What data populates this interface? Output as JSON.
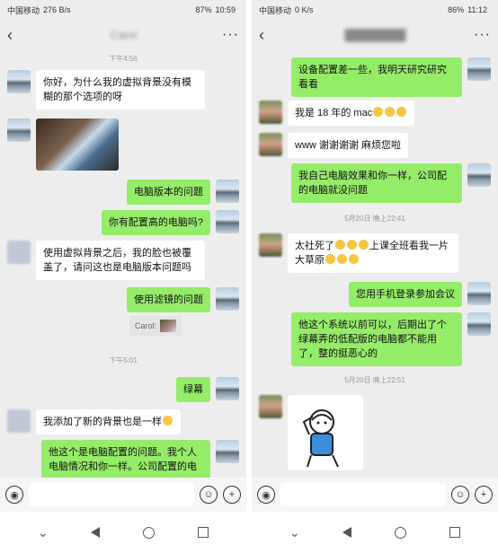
{
  "left": {
    "status": {
      "carrier": "中国移动",
      "data": "276 B/s",
      "battery": "87%",
      "time": "10:59"
    },
    "contact_name": "Carol",
    "timestamps": [
      "下午4:56",
      "下午5:01"
    ],
    "messages": [
      {
        "text": "你好，为什么我的虚拟背景没有模糊的那个选项的呀"
      },
      {
        "text": "电脑版本的问题"
      },
      {
        "text": "你有配置高的电脑吗?"
      },
      {
        "text": "使用虚拟背景之后，我的脸也被覆盖了，请问这也是电脑版本问题吗"
      },
      {
        "text": "使用滤镜的问题"
      },
      {
        "text": "绿幕"
      },
      {
        "text": "我添加了新的背景也是一样"
      },
      {
        "text": "他这个是电脑配置的问题。我个人电脑情况和你一样。公司配置的电"
      }
    ],
    "quote_label": "Carol:"
  },
  "right": {
    "status": {
      "carrier": "中国移动",
      "data": "0 K/s",
      "battery": "86%",
      "time": "11:12"
    },
    "contact_name": "████████",
    "timestamps": [
      "5月20日 晚上22:41",
      "5月20日 晚上22:51"
    ],
    "messages": [
      {
        "text": "设备配置差一些，我明天研究研究看看"
      },
      {
        "text": "我是 18 年的 mac"
      },
      {
        "text": "www 谢谢谢谢 麻烦您啦"
      },
      {
        "text": "我自己电脑效果和你一样，公司配的电脑就没问题"
      },
      {
        "text": "太社死了"
      },
      {
        "text": "上课全班看我一片大草原"
      },
      {
        "text": "您用手机登录参加会议"
      },
      {
        "text": "他这个系统以前可以，后期出了个绿幕弄的低配版的电脑都不能用了，整的挺恶心的"
      }
    ]
  },
  "icons": {
    "back": "‹",
    "more": "···",
    "voice": "voice-icon",
    "emoji": "emoji-icon",
    "plus": "plus-icon"
  },
  "colors": {
    "outgoing_bubble": "#95ec69",
    "incoming_bubble": "#ffffff",
    "chat_bg": "#ededed"
  }
}
